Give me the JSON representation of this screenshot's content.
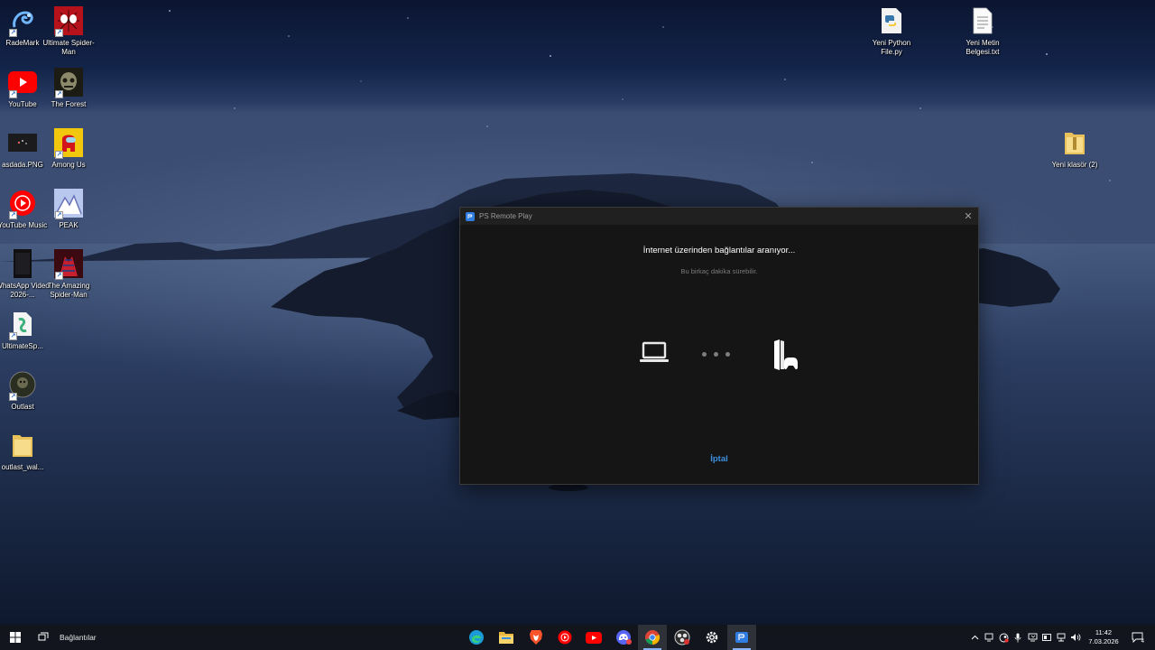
{
  "desktop": {
    "icons_left": [
      {
        "label": "RadeMark",
        "icon": "rademark-icon"
      },
      {
        "label": "Ultimate Spider-Man",
        "icon": "spiderman-icon"
      },
      {
        "label": "YouTube",
        "icon": "youtube-icon"
      },
      {
        "label": "The Forest",
        "icon": "the-forest-icon"
      },
      {
        "label": "asdada.PNG",
        "icon": "image-file-icon"
      },
      {
        "label": "Among Us",
        "icon": "among-us-icon"
      },
      {
        "label": "YouTube Music",
        "icon": "youtube-music-icon"
      },
      {
        "label": "PEAK",
        "icon": "peak-icon"
      },
      {
        "label": "WhatsApp Video 2026-...",
        "icon": "video-file-icon"
      },
      {
        "label": "The Amazing Spider-Man",
        "icon": "amazing-spiderman-icon"
      },
      {
        "label": "UltimateSp...",
        "icon": "ultimatesp-file-icon"
      },
      {
        "label": "Outlast",
        "icon": "outlast-icon"
      },
      {
        "label": "outlast_wal...",
        "icon": "folder-icon"
      }
    ],
    "icons_right": [
      {
        "label": "Yeni Python File.py",
        "icon": "python-file-icon"
      },
      {
        "label": "Yeni Metin Belgesi.txt",
        "icon": "text-file-icon"
      },
      {
        "label": "Yeni klasör (2)",
        "icon": "zip-folder-icon"
      }
    ]
  },
  "dialog": {
    "title": "PS Remote Play",
    "close_glyph": "✕",
    "status_title": "İnternet üzerinden bağlantılar aranıyor...",
    "status_subtitle": "Bu birkaç dakika sürebilir.",
    "cancel_label": "İptal",
    "accent_color": "#3d8fe0"
  },
  "taskbar": {
    "search_label": "Bağlantılar",
    "apps": [
      {
        "name": "edge-icon",
        "active": false
      },
      {
        "name": "file-explorer-icon",
        "active": false
      },
      {
        "name": "brave-icon",
        "active": false
      },
      {
        "name": "youtube-music-icon",
        "active": false
      },
      {
        "name": "youtube-icon",
        "active": false
      },
      {
        "name": "discord-icon",
        "active": false
      },
      {
        "name": "chrome-icon",
        "active": true
      },
      {
        "name": "obs-icon",
        "active": false
      },
      {
        "name": "settings-icon",
        "active": false
      },
      {
        "name": "ps-remote-play-icon",
        "active": true
      }
    ],
    "tray": [
      "chevron-up-icon",
      "meet-now-icon",
      "steam-icon",
      "microphone-icon",
      "display-icon",
      "network-icon",
      "volume-icon"
    ],
    "time": "11:42",
    "date": "7.03.2026",
    "notification_count": "4"
  }
}
